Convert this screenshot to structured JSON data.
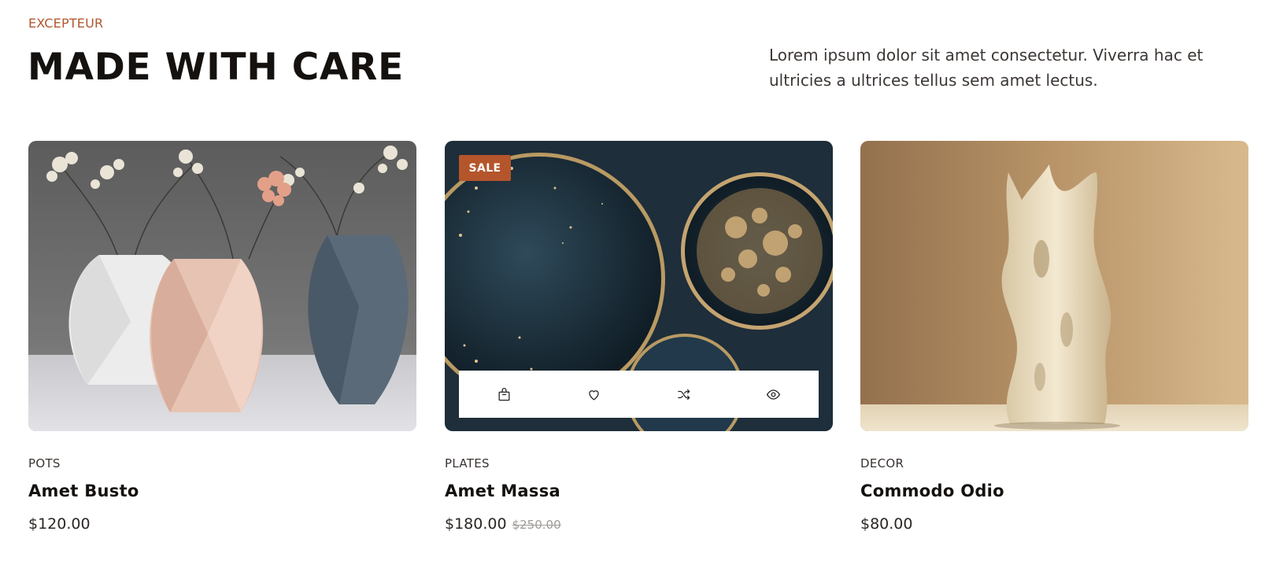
{
  "header": {
    "eyebrow": "EXCEPTEUR",
    "title": "MADE WITH CARE",
    "intro": "Lorem ipsum dolor sit amet consectetur. Viverra hac et ultricies a ultrices tellus sem amet lectus."
  },
  "products": [
    {
      "category": "POTS",
      "name": "Amet Busto",
      "price": "$120.00",
      "image": "faceted vases with flowers"
    },
    {
      "category": "PLATES",
      "name": "Amet Massa",
      "price": "$180.00",
      "old_price": "$250.00",
      "badge": "SALE",
      "image": "dark speckled plates",
      "actions": [
        {
          "icon": "shopping-bag-icon"
        },
        {
          "icon": "heart-icon"
        },
        {
          "icon": "shuffle-icon"
        },
        {
          "icon": "eye-icon"
        }
      ]
    },
    {
      "category": "DECOR",
      "name": "Commodo Odio",
      "price": "$80.00",
      "image": "sculptural cream vase"
    }
  ],
  "colors": {
    "accent": "#b4552c",
    "eyebrow": "#b0582f",
    "title": "#15110f"
  }
}
